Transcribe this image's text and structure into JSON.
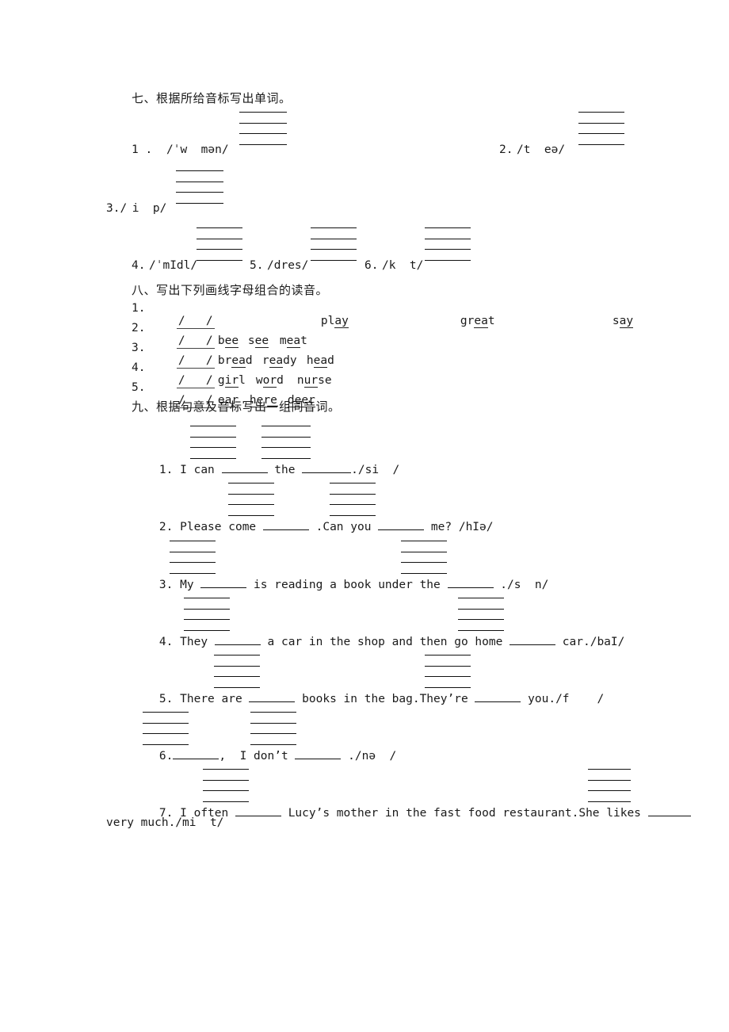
{
  "document": {
    "language": "zh-CN",
    "type": "english-worksheet"
  },
  "sections": [
    {
      "id": "section-7",
      "heading": "七、根据所给音标写出单词。",
      "items": [
        {
          "number": "1 .",
          "phonetic": "/ˈw  mən/"
        },
        {
          "number": "2.",
          "phonetic": "/t  eə/"
        },
        {
          "number": "3./",
          "phonetic": " i  p/"
        },
        {
          "number": "4.",
          "phonetic": "/ˈmIdl/"
        },
        {
          "number": "5.",
          "phonetic": "/dres/"
        },
        {
          "number": "6.",
          "phonetic": "/k  t/"
        }
      ]
    },
    {
      "id": "section-8",
      "heading": "八、写出下列画线字母组合的读音。",
      "rows": [
        {
          "number": "1.",
          "answer": "/   /",
          "words": [
            {
              "pre": "pl",
              "mid": "ay",
              "post": ""
            },
            {
              "pre": "gr",
              "mid": "ea",
              "post": "t"
            },
            {
              "pre": "s",
              "mid": "ay",
              "post": ""
            }
          ]
        },
        {
          "number": "2.",
          "answer": "/   /",
          "words": [
            {
              "pre": "b",
              "mid": "ee",
              "post": ""
            },
            {
              "pre": "s",
              "mid": "ee",
              "post": ""
            },
            {
              "pre": "m",
              "mid": "ea",
              "post": "t"
            }
          ]
        },
        {
          "number": "3.",
          "answer": "/   /",
          "words": [
            {
              "pre": "br",
              "mid": "ea",
              "post": "d"
            },
            {
              "pre": "r",
              "mid": "ea",
              "post": "dy"
            },
            {
              "pre": "h",
              "mid": "ea",
              "post": "d"
            }
          ]
        },
        {
          "number": "4.",
          "answer": "/   /",
          "words": [
            {
              "pre": "g",
              "mid": "ir",
              "post": "l"
            },
            {
              "pre": "w",
              "mid": "or",
              "post": "d"
            },
            {
              "pre": "n",
              "mid": "ur",
              "post": "se"
            }
          ]
        },
        {
          "number": "5.",
          "answer": "/   /",
          "words": [
            {
              "pre": "",
              "mid": "ear",
              "post": ""
            },
            {
              "pre": "",
              "mid": "here",
              "post": ""
            },
            {
              "pre": "",
              "mid": "deer",
              "post": ""
            }
          ]
        }
      ]
    },
    {
      "id": "section-9",
      "heading": "九、根据句意及音标写出一组同音词。",
      "questions": [
        {
          "number": "1.",
          "part1": "I can ",
          "part2": " the ",
          "part3": "./si  /"
        },
        {
          "number": "2.",
          "part1": "Please come ",
          "part2": " .Can you ",
          "part3": " me? /hIə/"
        },
        {
          "number": "3.",
          "part1": "My ",
          "part2": " is reading a book under the ",
          "part3": " ./s  n/"
        },
        {
          "number": "4.",
          "part1": "They ",
          "part2": " a car in the shop and then go home ",
          "part3": " car./baI/"
        },
        {
          "number": "5.",
          "part1": "There are ",
          "part2": " books in the bag.They’re ",
          "part3": " you./f    /"
        },
        {
          "number": "6.",
          "part1": "",
          "part2": ",  I don’t ",
          "part3": " ./nə  /"
        },
        {
          "number": "7.",
          "part1": "I often ",
          "part2": " Lucy’s mother in the fast food restaurant.She likes ",
          "part3": "",
          "continuation": "very much./mi  t/"
        }
      ]
    }
  ]
}
